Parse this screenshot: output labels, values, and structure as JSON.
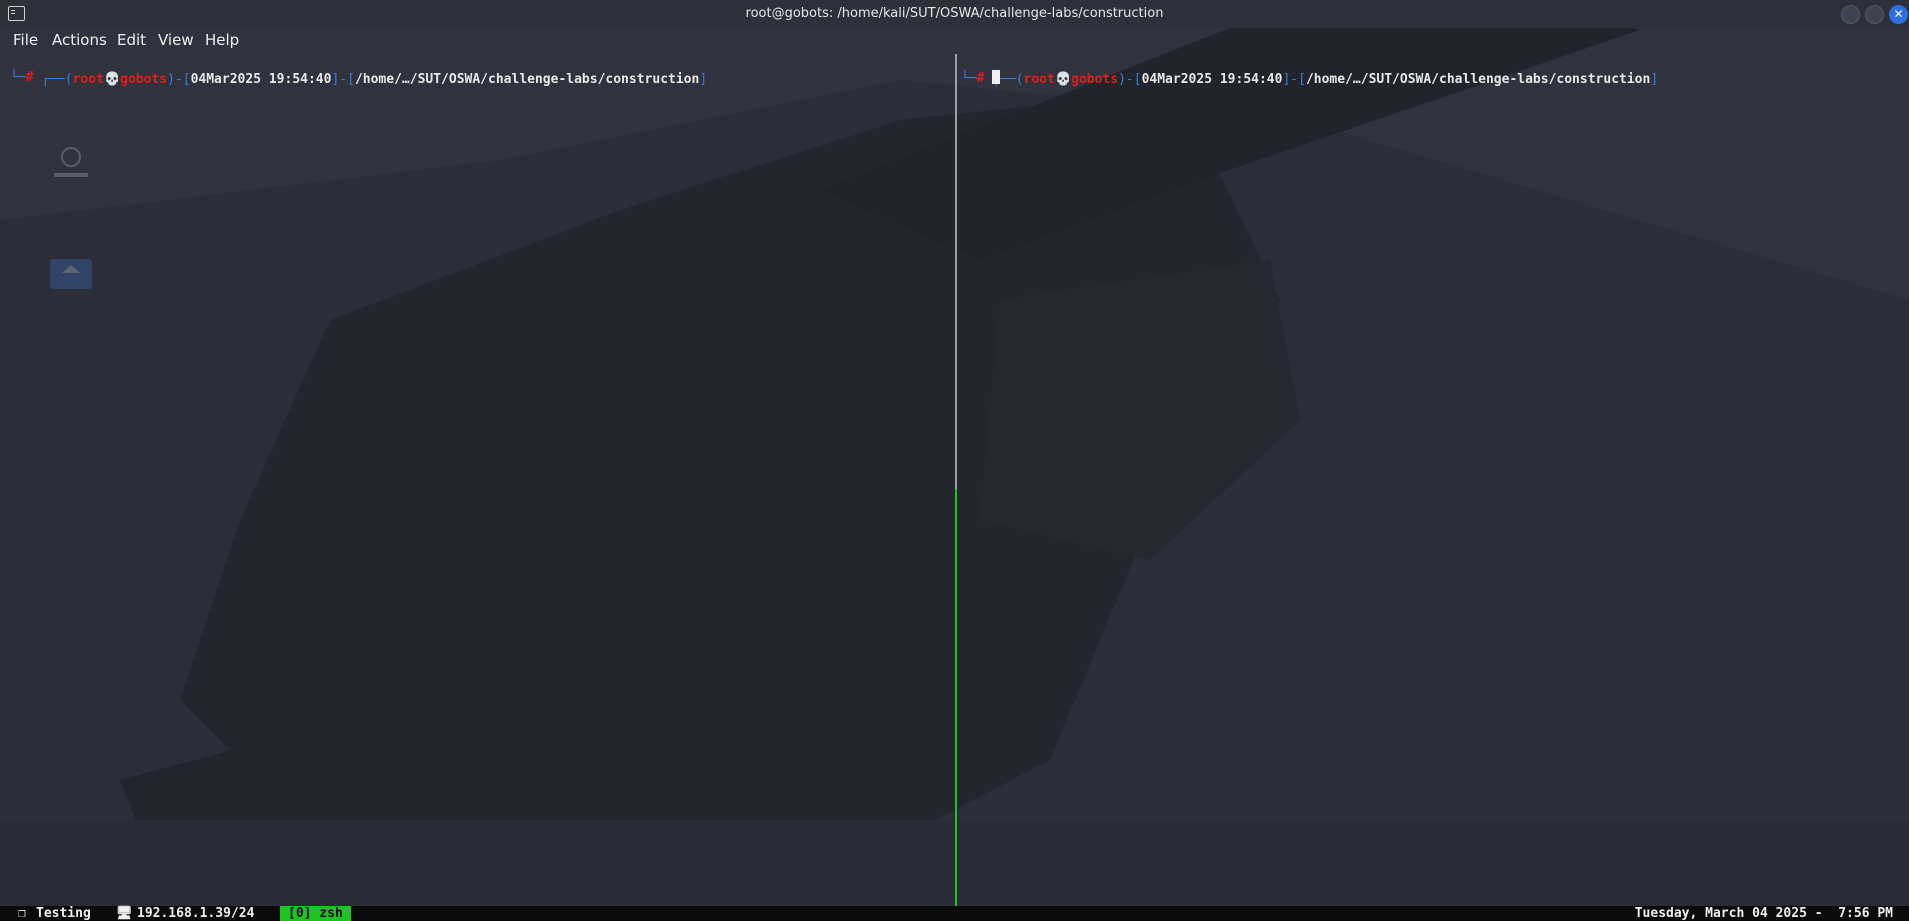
{
  "window": {
    "title": "root@gobots: /home/kali/SUT/OSWA/challenge-labs/construction",
    "close_glyph": "✕"
  },
  "menu": [
    "File",
    "Actions",
    "Edit",
    "View",
    "Help"
  ],
  "panes": [
    {
      "user": "root",
      "skull": "💀",
      "host": "gobots",
      "datetime": "04Mar2025 19:54:40",
      "path": "/home/…/SUT/OSWA/challenge-labs/construction",
      "symbol": "#"
    },
    {
      "user": "root",
      "skull": "💀",
      "host": "gobots",
      "datetime": "04Mar2025 19:54:40",
      "path": "/home/…/SUT/OSWA/challenge-labs/construction",
      "symbol": "#"
    }
  ],
  "statusbar": {
    "session_icon": "❐",
    "session": "Testing",
    "ip_icon": "🖥",
    "ip": "192.168.1.39/24",
    "window_tab": "[0] zsh",
    "clock": "Tuesday, March 04 2025 -  7:56 PM"
  },
  "colors": {
    "accent_green": "#1ec51e",
    "prompt_red": "#e21b1b",
    "prompt_blue": "#3b7bd8",
    "close_button": "#2d6fe0"
  }
}
